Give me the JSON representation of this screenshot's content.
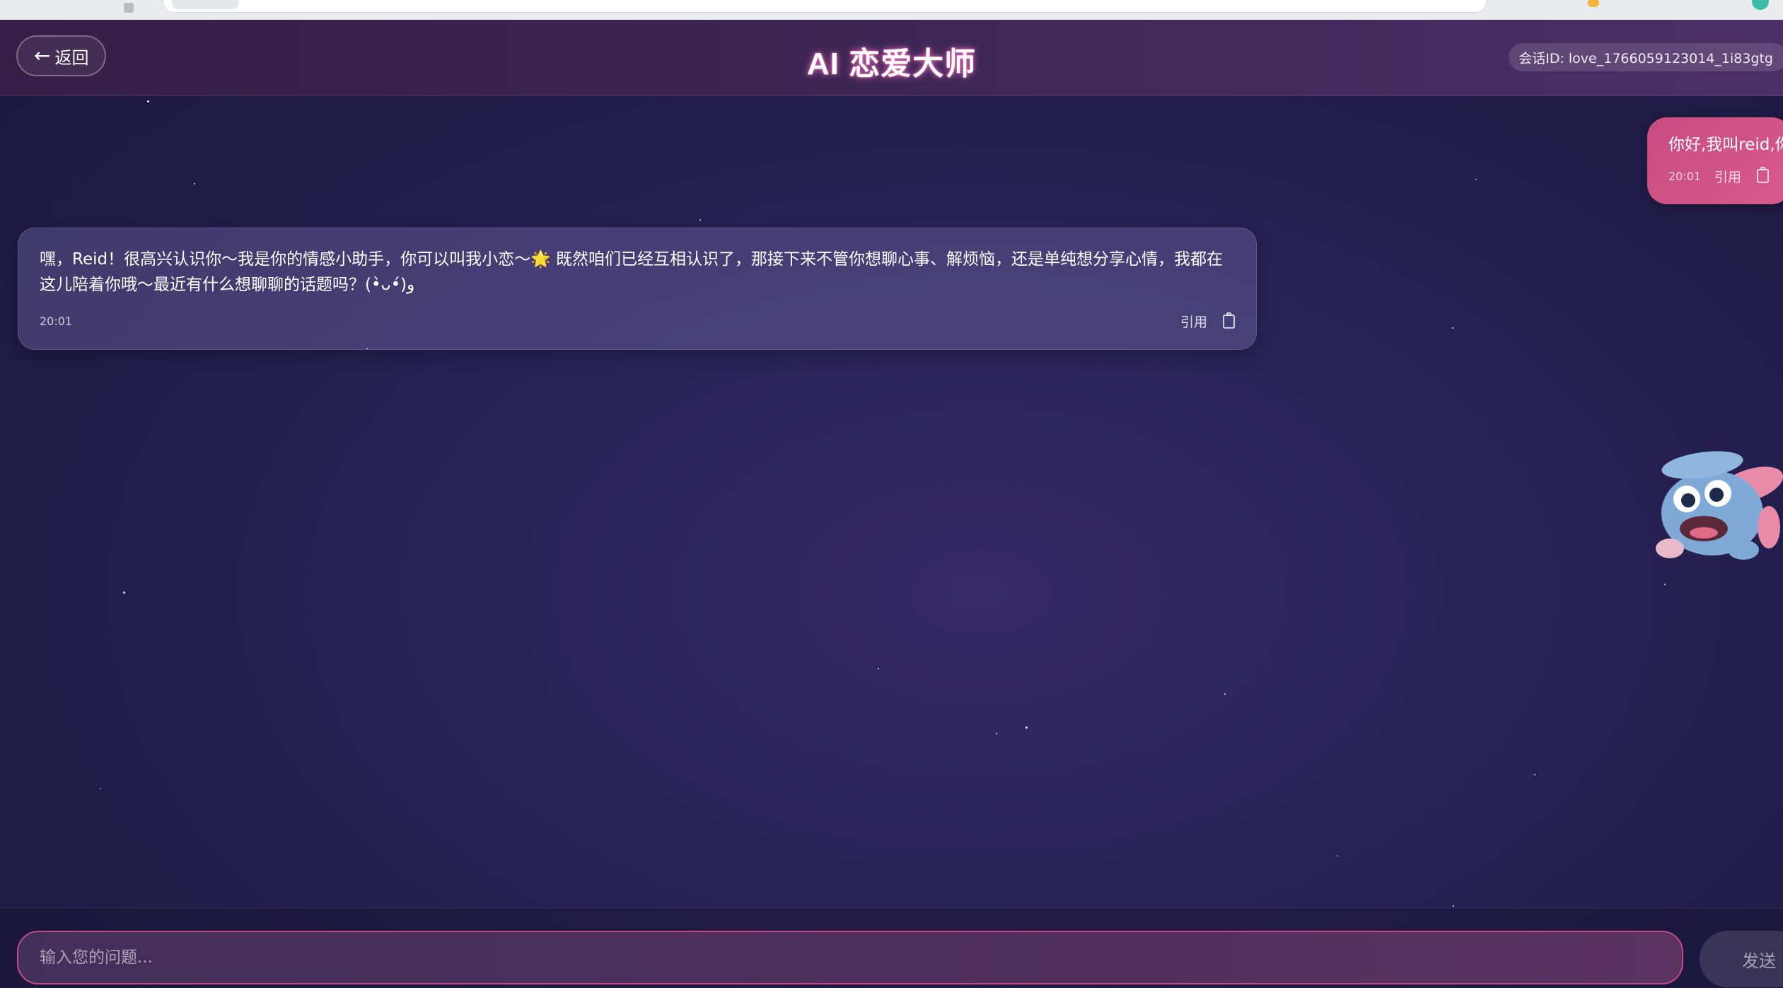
{
  "app": {
    "title": "AI 恋爱大师",
    "back_label": "返回",
    "session_label": "会话ID: love_1766059123014_1i83gtg"
  },
  "colors": {
    "accent_pink": "#d85a8b",
    "input_border": "#c24a86",
    "background": "#2a2358"
  },
  "messages": [
    {
      "role": "user",
      "text": "你好,我叫reid,你呢",
      "time": "20:01",
      "quote_label": "引用",
      "copy_icon": "clipboard-icon"
    },
    {
      "role": "assistant",
      "text": "嘿，Reid！很高兴认识你～我是你的情感小助手，你可以叫我小恋～🌟 既然咱们已经互相认识了，那接下来不管你想聊心事、解烦恼，还是单纯想分享心情，我都在这儿陪着你哦～最近有什么想聊聊的话题吗？(•̀ᴗ•́)و",
      "time": "20:01",
      "quote_label": "引用",
      "copy_icon": "clipboard-icon"
    }
  ],
  "composer": {
    "placeholder": "输入您的问题...",
    "value": "",
    "send_label": "发送"
  }
}
